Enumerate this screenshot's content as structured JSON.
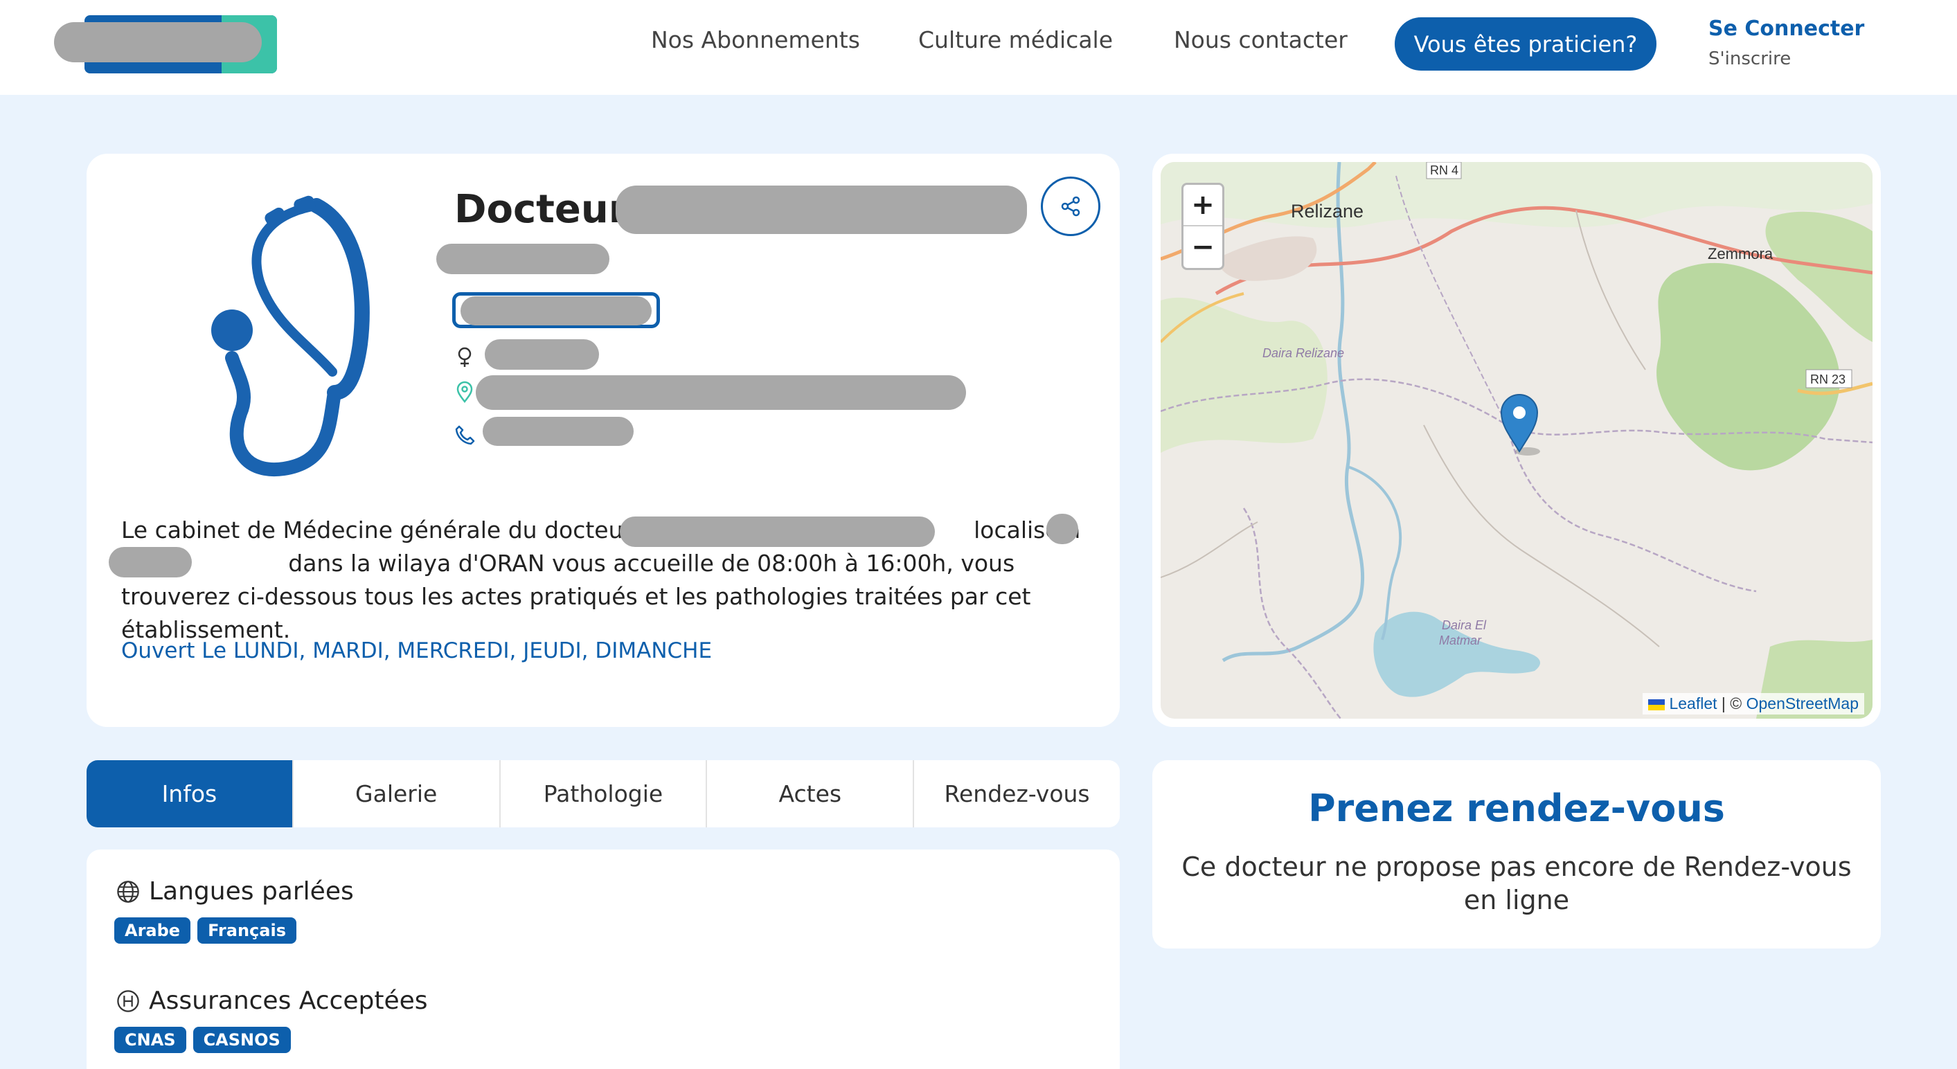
{
  "header": {
    "nav": [
      "Nos Abonnements",
      "Culture médicale",
      "Nous contacter"
    ],
    "cta": "Vous êtes praticien?",
    "login": "Se Connecter",
    "signup": "S'inscrire"
  },
  "profile": {
    "title": "Docteur",
    "description": "Le cabinet de Médecine générale du docteur                                               localisé à                        dans la wilaya d'ORAN vous accueille de 08:00h à 16:00h, vous trouverez ci-dessous tous les actes pratiqués et les pathologies traitées par cet établissement.",
    "open_days": "Ouvert Le LUNDI, MARDI, MERCREDI, JEUDI, DIMANCHE"
  },
  "map": {
    "labels": {
      "relizane": "Relizane",
      "zemmora": "Zemmora",
      "rn4": "RN 4",
      "rn23": "RN 23",
      "daira_relizane": "Daira Relizane",
      "daira_el_matmar_1": "Daira El",
      "daira_el_matmar_2": "Matmar"
    },
    "zoom_in": "+",
    "zoom_out": "−",
    "attribution_leaflet": "Leaflet",
    "attribution_sep": " | © ",
    "attribution_osm": "OpenStreetMap"
  },
  "tabs": [
    "Infos",
    "Galerie",
    "Pathologie",
    "Actes",
    "Rendez-vous"
  ],
  "info": {
    "languages_title": "Langues parlées",
    "languages": [
      "Arabe",
      "Français"
    ],
    "insurance_title": "Assurances Acceptées",
    "insurances": [
      "CNAS",
      "CASNOS"
    ]
  },
  "rdv": {
    "title": "Prenez rendez-vous",
    "text": "Ce docteur ne propose pas encore de Rendez-vous en ligne"
  },
  "colors": {
    "primary": "#0d5fac",
    "accent_teal": "#3cc2a8",
    "page_bg": "#eaf3fd"
  }
}
